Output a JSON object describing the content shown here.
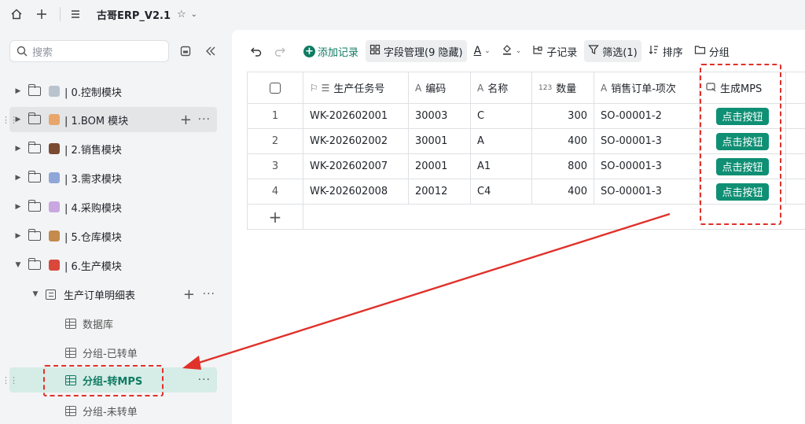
{
  "topbar": {
    "title": "古哥ERP_V2.1",
    "icons": [
      "home-icon",
      "plus-icon",
      "menu-icon",
      "star-icon",
      "chevron-down-icon"
    ]
  },
  "sidebar": {
    "search_placeholder": "搜索",
    "items": [
      {
        "label": "| 0.控制模块",
        "icon": "gear-emoji"
      },
      {
        "label": "| 1.BOM 模块",
        "icon": "clipboard-emoji"
      },
      {
        "label": "| 2.销售模块",
        "icon": "briefcase-emoji"
      },
      {
        "label": "| 3.需求模块",
        "icon": "calendar-emoji"
      },
      {
        "label": "| 4.采购模块",
        "icon": "cart-emoji"
      },
      {
        "label": "| 5.仓库模块",
        "icon": "package-emoji"
      },
      {
        "label": "| 6.生产模块",
        "icon": "book-emoji"
      }
    ],
    "sub_table": "生产订单明细表",
    "views": [
      "数据库",
      "分组-已转单",
      "分组-转MPS",
      "分组-未转单"
    ]
  },
  "toolbar": {
    "add_record": "添加记录",
    "field_manage": "字段管理(9 隐藏)",
    "sub_record": "子记录",
    "filter": "筛选(1)",
    "sort": "排序",
    "group": "分组"
  },
  "table": {
    "columns": [
      "生产任务号",
      "编码",
      "名称",
      "数量",
      "销售订单-项次",
      "生成MPS"
    ],
    "column_icons": [
      "flag-list-icon",
      "text-icon",
      "text-icon",
      "number-icon",
      "text-icon",
      "button-field-icon"
    ],
    "number_icon_text": "123",
    "button_label": "点击按钮",
    "rows": [
      {
        "idx": "1",
        "task": "WK-202602001",
        "code": "30003",
        "name": "C",
        "qty": "300",
        "so": "SO-00001-2"
      },
      {
        "idx": "2",
        "task": "WK-202602002",
        "code": "30001",
        "name": "A",
        "qty": "400",
        "so": "SO-00001-3"
      },
      {
        "idx": "3",
        "task": "WK-202602007",
        "code": "20001",
        "name": "A1",
        "qty": "800",
        "so": "SO-00001-3"
      },
      {
        "idx": "4",
        "task": "WK-202602008",
        "code": "20012",
        "name": "C4",
        "qty": "400",
        "so": "SO-00001-3"
      }
    ]
  },
  "colors": {
    "accent": "#0f7b63",
    "button": "#0f8f74",
    "annotation": "#e0312a",
    "active_bg": "#d6ece7"
  }
}
